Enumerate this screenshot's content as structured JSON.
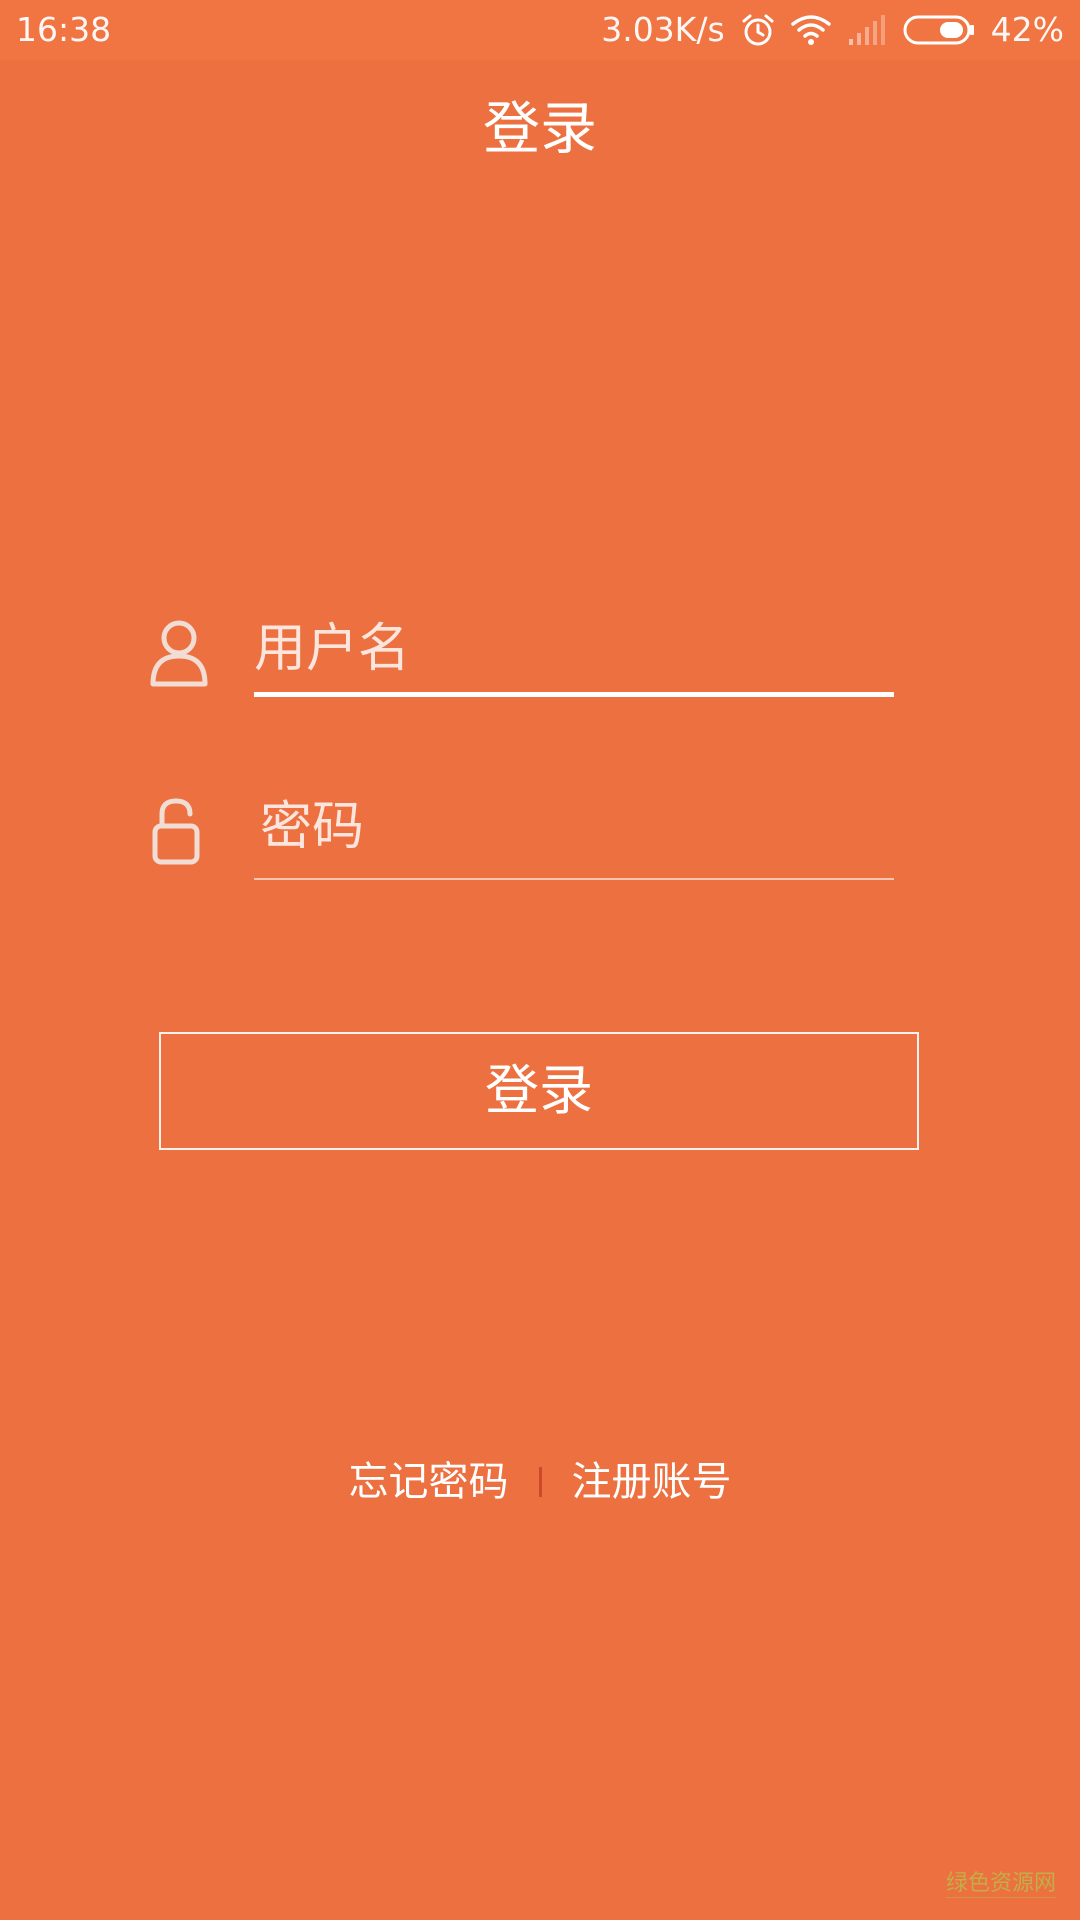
{
  "status_bar": {
    "time": "16:38",
    "network_speed": "3.03K/s",
    "battery_percent": "42%",
    "battery_level": 0.42,
    "icons": [
      "alarm-icon",
      "wifi-icon",
      "signal-icon",
      "battery-icon"
    ]
  },
  "header": {
    "title": "登录"
  },
  "form": {
    "username": {
      "placeholder": "用户名",
      "value": "",
      "icon": "user-icon"
    },
    "password": {
      "placeholder": "密码",
      "value": "",
      "icon": "unlock-icon"
    },
    "login_button": "登录"
  },
  "footer": {
    "forgot_password": "忘记密码",
    "register": "注册账号"
  },
  "watermark": "绿色资源网",
  "colors": {
    "background": "#ec7040",
    "status_bar": "#f07542",
    "divider": "#cc4a2a"
  }
}
